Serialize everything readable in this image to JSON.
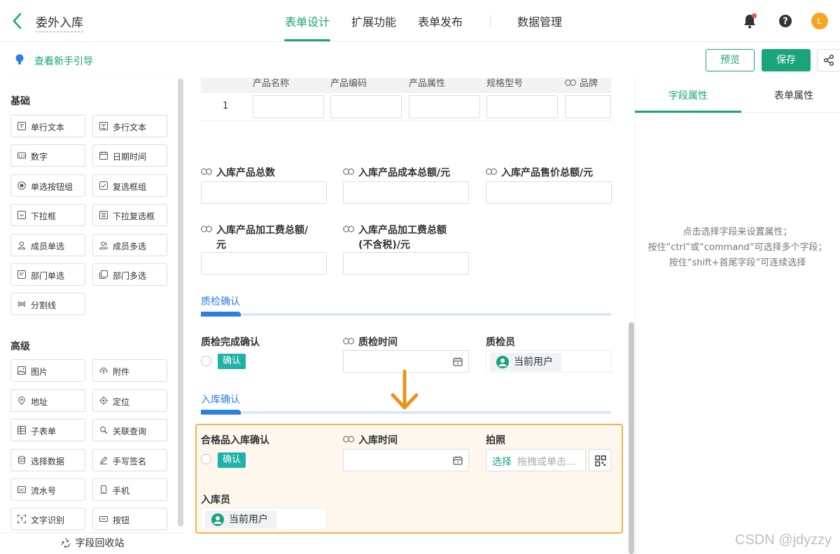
{
  "header": {
    "title": "委外入库",
    "tabs": [
      {
        "label": "表单设计",
        "active": true
      },
      {
        "label": "扩展功能",
        "active": false
      },
      {
        "label": "表单发布",
        "active": false
      },
      {
        "label": "数据管理",
        "active": false
      }
    ],
    "avatar_initial": "L",
    "accent_color": "#1aa47a"
  },
  "subbar": {
    "guide_link": "查看新手引导",
    "preview_label": "预览",
    "save_label": "保存"
  },
  "left_panel": {
    "basic_title": "基础",
    "basic_items": [
      {
        "label": "单行文本",
        "icon": "text-line-icon"
      },
      {
        "label": "多行文本",
        "icon": "text-area-icon"
      },
      {
        "label": "数字",
        "icon": "number-icon"
      },
      {
        "label": "日期时间",
        "icon": "calendar-icon"
      },
      {
        "label": "单选按钮组",
        "icon": "radio-icon"
      },
      {
        "label": "复选框组",
        "icon": "checkbox-icon"
      },
      {
        "label": "下拉框",
        "icon": "dropdown-icon"
      },
      {
        "label": "下拉复选框",
        "icon": "multi-dropdown-icon"
      },
      {
        "label": "成员单选",
        "icon": "member-icon"
      },
      {
        "label": "成员多选",
        "icon": "members-icon"
      },
      {
        "label": "部门单选",
        "icon": "department-icon"
      },
      {
        "label": "部门多选",
        "icon": "departments-icon"
      },
      {
        "label": "分割线",
        "icon": "divider-icon"
      }
    ],
    "advanced_title": "高级",
    "advanced_items": [
      {
        "label": "图片",
        "icon": "image-icon"
      },
      {
        "label": "附件",
        "icon": "attachment-icon"
      },
      {
        "label": "地址",
        "icon": "location-pin-icon"
      },
      {
        "label": "定位",
        "icon": "target-icon"
      },
      {
        "label": "子表单",
        "icon": "subform-icon"
      },
      {
        "label": "关联查询",
        "icon": "link-query-icon"
      },
      {
        "label": "选择数据",
        "icon": "database-icon"
      },
      {
        "label": "手写签名",
        "icon": "pen-icon"
      },
      {
        "label": "流水号",
        "icon": "serial-number-icon"
      },
      {
        "label": "手机",
        "icon": "phone-icon"
      },
      {
        "label": "文字识别",
        "icon": "ocr-icon"
      },
      {
        "label": "按钮",
        "icon": "button-icon"
      }
    ],
    "recycle_label": "字段回收站"
  },
  "canvas": {
    "table_headers": [
      "产品名称",
      "产品编码",
      "产品属性",
      "规格型号",
      "品牌"
    ],
    "table_row_number": "1",
    "fields_row1": [
      "入库产品总数",
      "入库产品成本总额/元",
      "入库产品售价总额/元"
    ],
    "field_processing_fee_line1": "入库产品加工费总额/",
    "field_processing_fee_line2": "元",
    "field_processing_fee_ex_line1": "入库产品加工费总额",
    "field_processing_fee_ex_line2": "(不含税)/元",
    "qc_section": {
      "title": "质检确认",
      "confirm_label": "质检完成确认",
      "confirm_tag": "确认",
      "time_label": "质检时间",
      "inspector_label": "质检员",
      "inspector_value": "当前用户"
    },
    "stock_section": {
      "title": "入库确认",
      "confirm_label": "合格品入库确认",
      "confirm_tag": "确认",
      "time_label": "入库时间",
      "photo_label": "拍照",
      "photo_select": "选择",
      "photo_placeholder": "拖拽或单击...",
      "stocker_label": "入库员",
      "stocker_value": "当前用户"
    }
  },
  "right_panel": {
    "tabs": [
      {
        "label": "字段属性",
        "active": true
      },
      {
        "label": "表单属性",
        "active": false
      }
    ],
    "hint_lines": [
      "点击选择字段来设置属性；",
      "按住“ctrl”或“command”可选择多个字段；",
      "按住“shift+首尾字段”可连续选择"
    ]
  },
  "watermark": "CSDN @jdyzzy"
}
